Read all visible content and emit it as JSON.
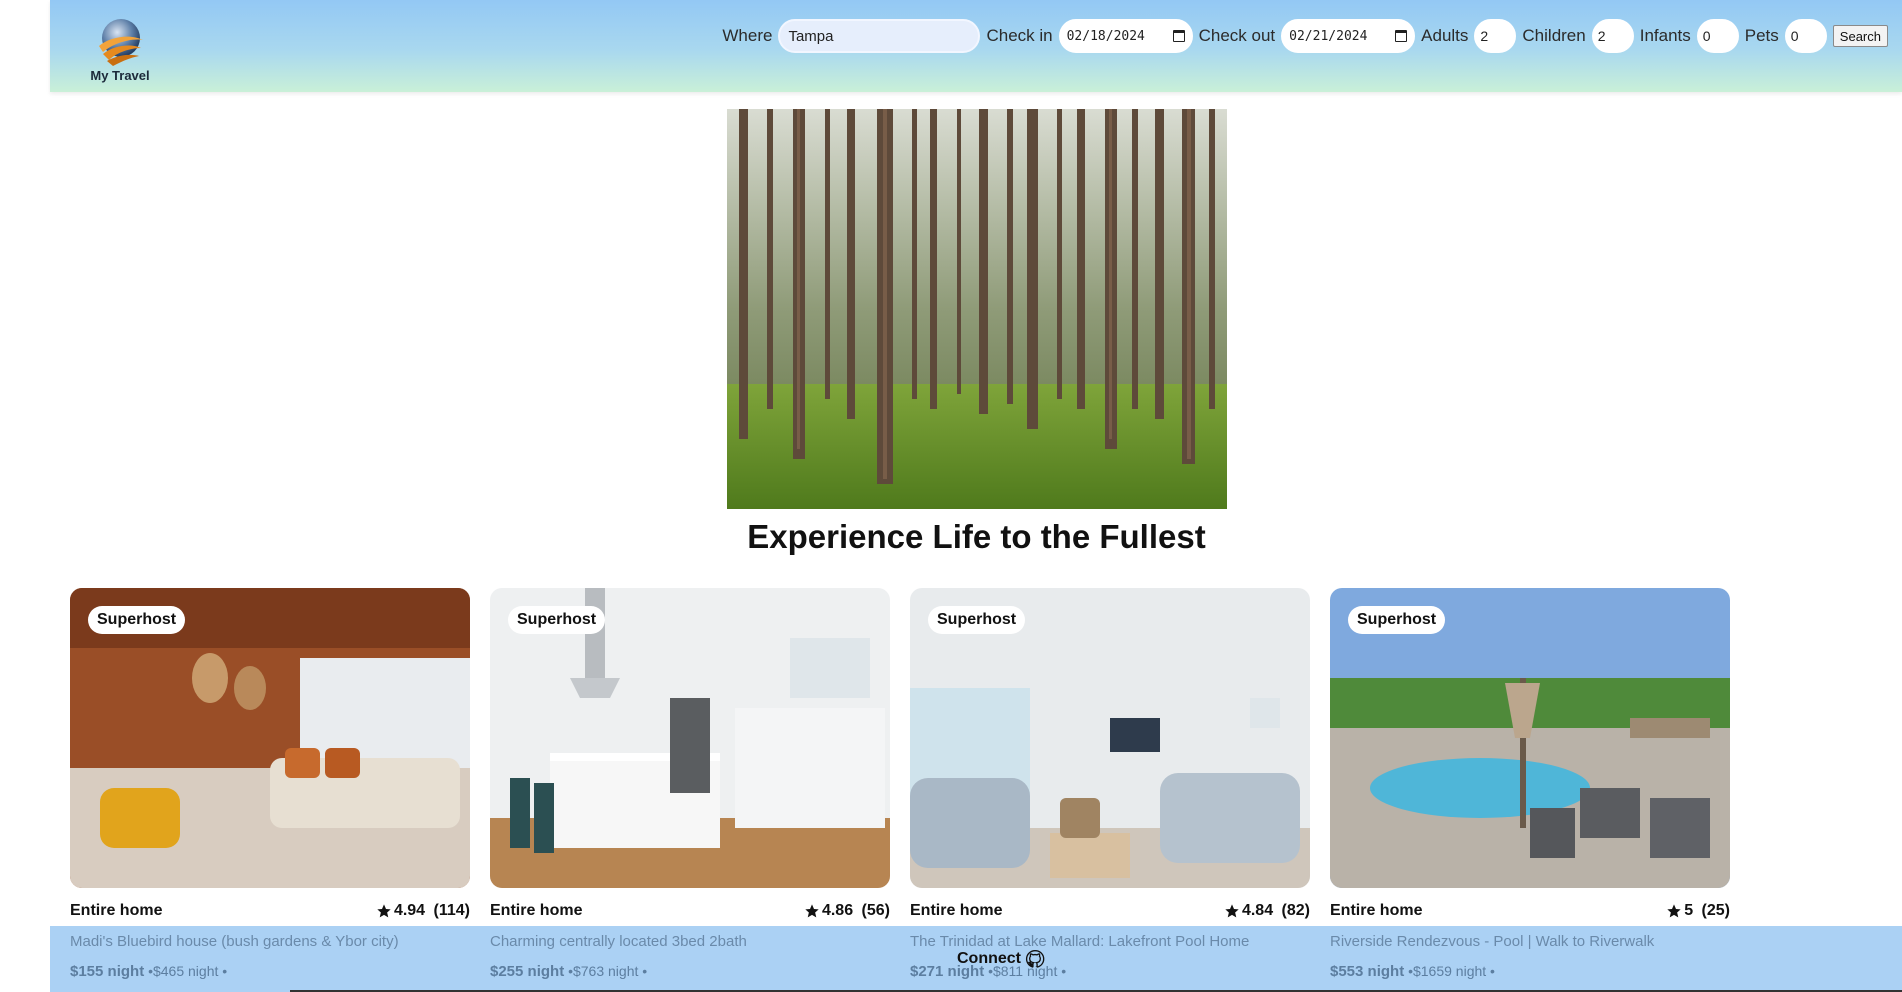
{
  "brand": {
    "name": "My Travel"
  },
  "search": {
    "where_label": "Where",
    "where_value": "Tampa",
    "checkin_label": "Check in",
    "checkin_value": "02/18/2024",
    "checkout_label": "Check out",
    "checkout_value": "02/21/2024",
    "adults_label": "Adults",
    "adults_value": "2",
    "children_label": "Children",
    "children_value": "2",
    "infants_label": "Infants",
    "infants_value": "0",
    "pets_label": "Pets",
    "pets_value": "0",
    "button_label": "Search"
  },
  "hero": {
    "title": "Experience Life to the Fullest"
  },
  "listings": [
    {
      "badge": "Superhost",
      "type": "Entire home",
      "rating": "4.94",
      "reviews": "(114)",
      "title": "Madi's Bluebird house (bush gardens & Ybor city)",
      "price_night": "$155 night",
      "price_total": "•$465 night •"
    },
    {
      "badge": "Superhost",
      "type": "Entire home",
      "rating": "4.86",
      "reviews": "(56)",
      "title": "Charming centrally located 3bed 2bath",
      "price_night": "$255 night",
      "price_total": "•$763 night •"
    },
    {
      "badge": "Superhost",
      "type": "Entire home",
      "rating": "4.84",
      "reviews": "(82)",
      "title": "The Trinidad at Lake Mallard: Lakefront Pool Home",
      "price_night": "$271 night",
      "price_total": "•$811 night •"
    },
    {
      "badge": "Superhost",
      "type": "Entire home",
      "rating": "5",
      "reviews": "(25)",
      "title": "Riverside Rendezvous - Pool | Walk to Riverwalk",
      "price_night": "$553 night",
      "price_total": "•$1659 night •"
    }
  ],
  "footer": {
    "connect_label": "Connect",
    "icon": "github-icon"
  },
  "colors": {
    "header_top": "#93c8f4",
    "header_bottom": "#c9f0d8",
    "footer": "#a8cff4",
    "link_text": "#6a8aaa"
  }
}
